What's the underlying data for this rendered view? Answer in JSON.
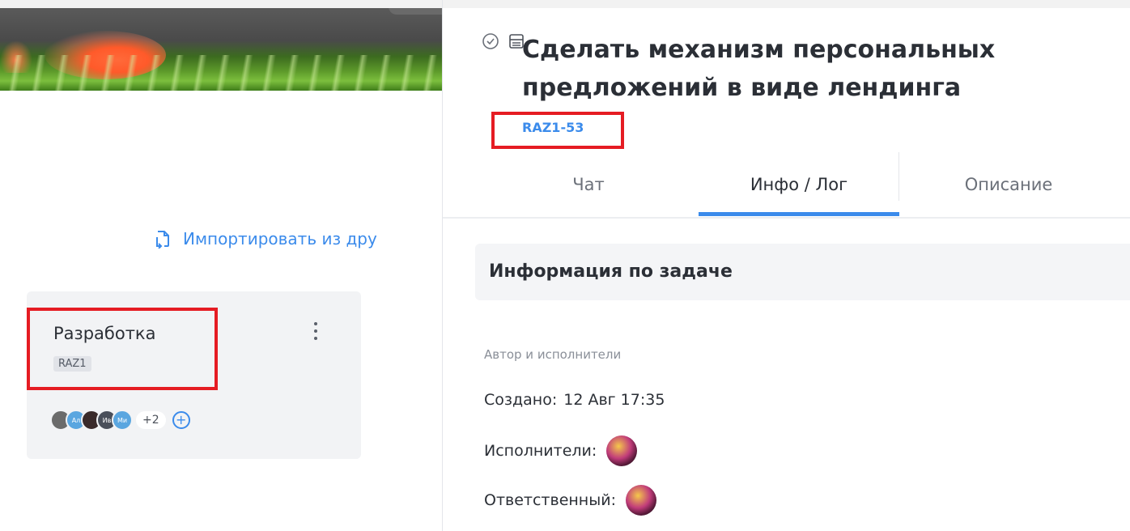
{
  "left": {
    "import_link": "Импортировать из дру",
    "project": {
      "name": "Разработка",
      "code": "RAZ1",
      "members": [
        {
          "initials": "",
          "color": "#6b6b6b"
        },
        {
          "initials": "Ал",
          "color": "#5aa6e0"
        },
        {
          "initials": "",
          "color": "#3a2a2a"
        },
        {
          "initials": "Ив",
          "color": "#4a4f5a"
        },
        {
          "initials": "Ми",
          "color": "#5aa6e0"
        }
      ],
      "more_count": "+2"
    }
  },
  "task": {
    "title": "Сделать механизм персональных предложений в виде лендинга",
    "key": "RAZ1-53",
    "tabs": [
      "Чат",
      "Инфо / Лог",
      "Описание"
    ],
    "active_tab": "Инфо / Лог",
    "info_title": "Информация по задаче",
    "section_label": "Автор и исполнители",
    "created_label": "Создано:",
    "created_value": "12 Авг 17:35",
    "assignees_label": "Исполнители:",
    "responsible_label": "Ответственный:"
  },
  "colors": {
    "accent": "#3b8beb",
    "highlight": "#e51c23"
  }
}
